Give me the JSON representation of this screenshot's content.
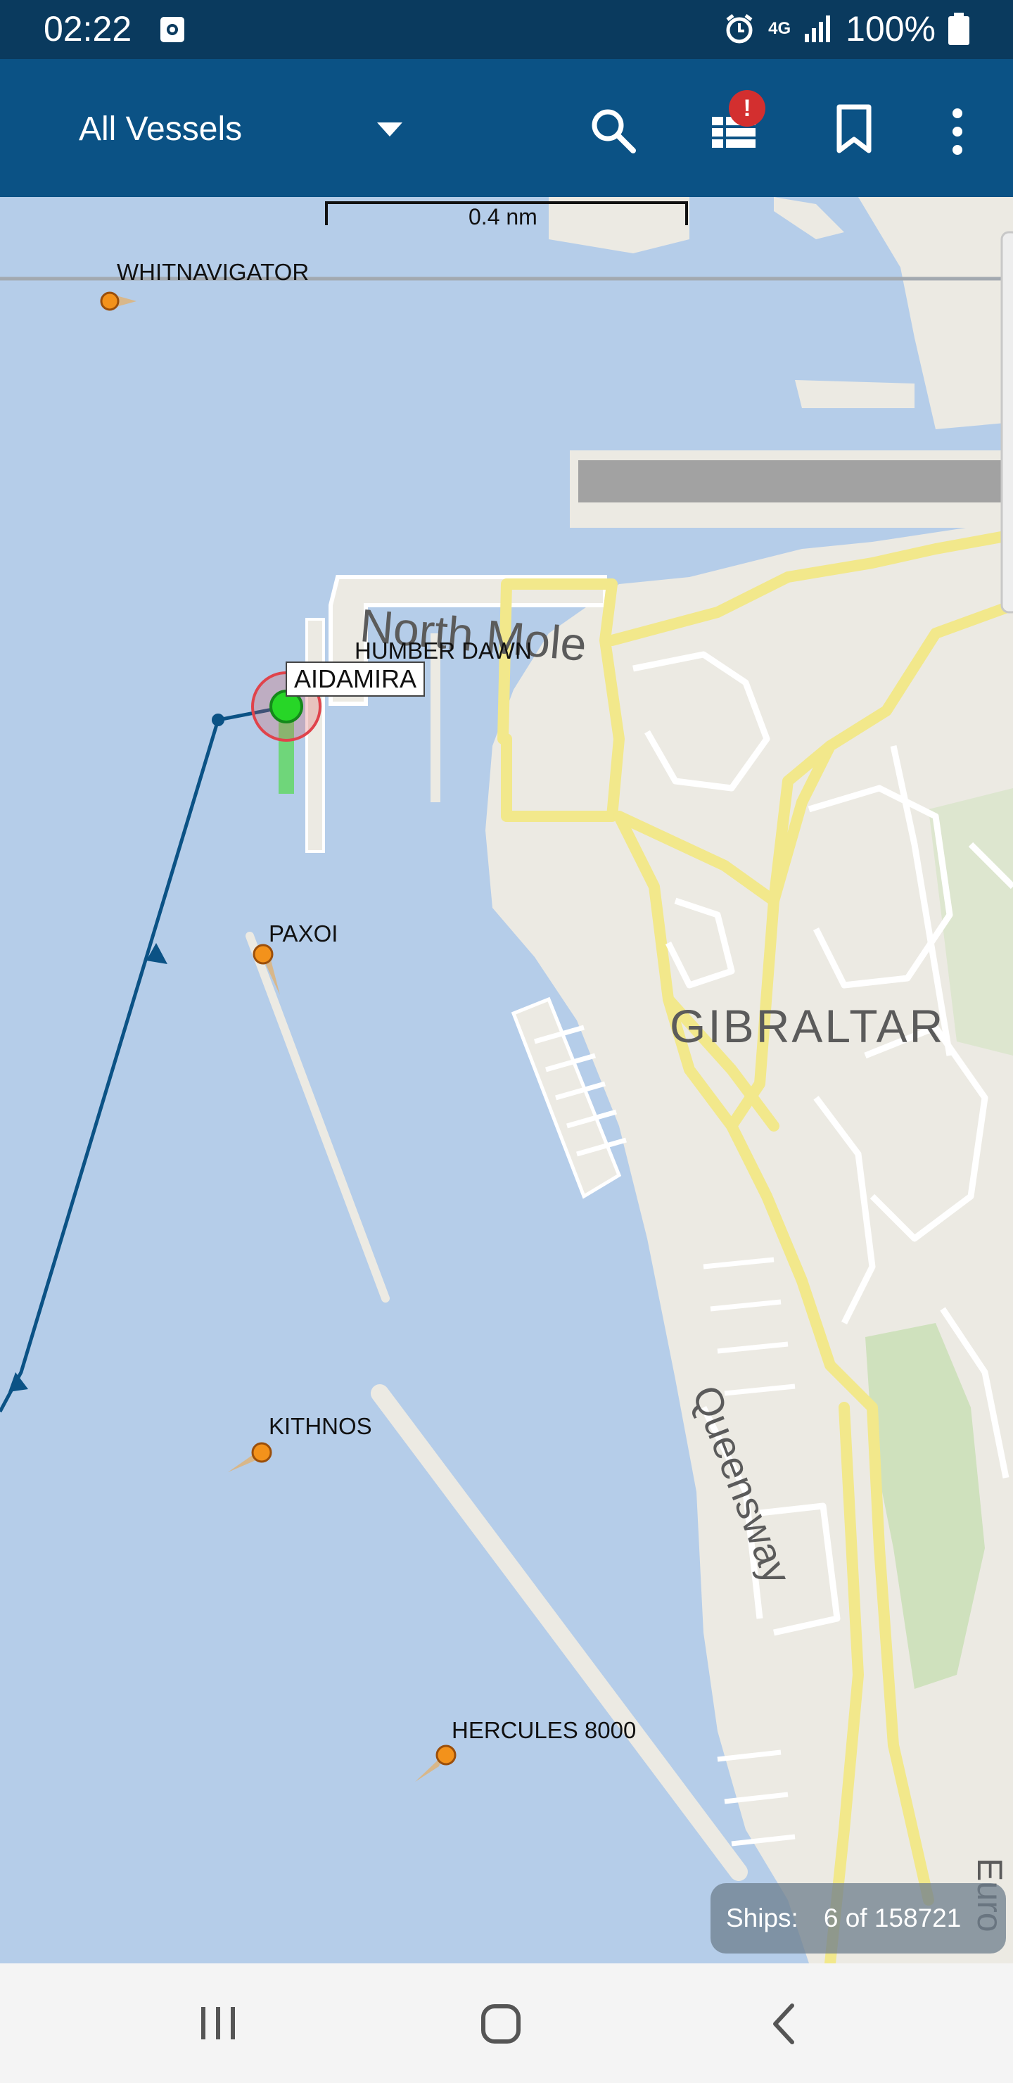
{
  "status": {
    "time": "02:22",
    "network": "4G",
    "battery": "100%"
  },
  "toolbar": {
    "filter_label": "All Vessels",
    "notification_badge": "!"
  },
  "map": {
    "scale_label": "0.4 nm",
    "place_labels": [
      "North Mole",
      "GIBRALTAR",
      "Queensway",
      "Euro"
    ],
    "vessels": [
      {
        "name": "WHITNAVIGATOR"
      },
      {
        "name": "HUMBER DAWN"
      },
      {
        "name": "AIDAMIRA",
        "selected": true
      },
      {
        "name": "PAXOI"
      },
      {
        "name": "KITHNOS"
      },
      {
        "name": "HERCULES 8000"
      }
    ]
  },
  "footer": {
    "ships_label": "Ships:",
    "ships_count": "6 of 158721"
  }
}
